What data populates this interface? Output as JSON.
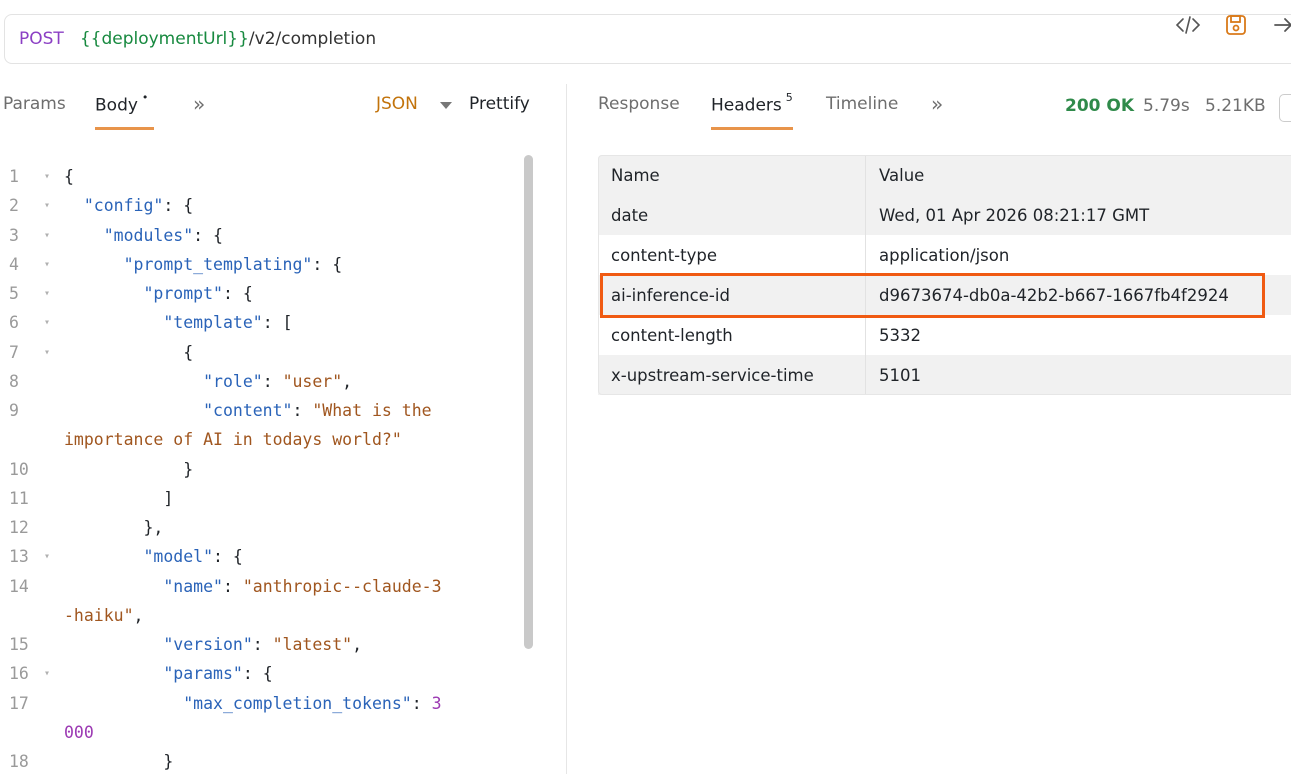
{
  "request": {
    "method": "POST",
    "url_var": "{{deploymentUrl}}",
    "url_path": "/v2/completion"
  },
  "icons": {
    "code": "code-icon",
    "save": "save-icon",
    "arrow": "arrow-right-icon"
  },
  "colors": {
    "accent": "#e8944a",
    "highlight": "#f05a12",
    "status_ok": "#2f8a4a"
  },
  "left_tabs": {
    "params": "Params",
    "body": "Body",
    "body_indicator": "•",
    "more": "»",
    "format": "JSON",
    "prettify": "Prettify"
  },
  "editor": {
    "lines": [
      {
        "num": "1",
        "fold": true,
        "code": [
          {
            "t": "p",
            "v": "{"
          }
        ]
      },
      {
        "num": "2",
        "fold": true,
        "code": [
          {
            "t": "p",
            "v": "  "
          },
          {
            "t": "k",
            "v": "\"config\""
          },
          {
            "t": "p",
            "v": ": {"
          }
        ]
      },
      {
        "num": "3",
        "fold": true,
        "code": [
          {
            "t": "p",
            "v": "    "
          },
          {
            "t": "k",
            "v": "\"modules\""
          },
          {
            "t": "p",
            "v": ": {"
          }
        ]
      },
      {
        "num": "4",
        "fold": true,
        "code": [
          {
            "t": "p",
            "v": "      "
          },
          {
            "t": "k",
            "v": "\"prompt_templating\""
          },
          {
            "t": "p",
            "v": ": {"
          }
        ]
      },
      {
        "num": "5",
        "fold": true,
        "code": [
          {
            "t": "p",
            "v": "        "
          },
          {
            "t": "k",
            "v": "\"prompt\""
          },
          {
            "t": "p",
            "v": ": {"
          }
        ]
      },
      {
        "num": "6",
        "fold": true,
        "code": [
          {
            "t": "p",
            "v": "          "
          },
          {
            "t": "k",
            "v": "\"template\""
          },
          {
            "t": "p",
            "v": ": ["
          }
        ]
      },
      {
        "num": "7",
        "fold": true,
        "code": [
          {
            "t": "p",
            "v": "            {"
          }
        ]
      },
      {
        "num": "8",
        "fold": false,
        "code": [
          {
            "t": "p",
            "v": "              "
          },
          {
            "t": "k",
            "v": "\"role\""
          },
          {
            "t": "p",
            "v": ": "
          },
          {
            "t": "s",
            "v": "\"user\""
          },
          {
            "t": "p",
            "v": ","
          }
        ]
      },
      {
        "num": "9",
        "fold": false,
        "code": [
          {
            "t": "p",
            "v": "              "
          },
          {
            "t": "k",
            "v": "\"content\""
          },
          {
            "t": "p",
            "v": ": "
          },
          {
            "t": "s",
            "v": "\"What is the"
          }
        ]
      },
      {
        "num": "",
        "fold": false,
        "code": [
          {
            "t": "s",
            "v": "importance of AI in todays world?\""
          }
        ]
      },
      {
        "num": "10",
        "fold": false,
        "code": [
          {
            "t": "p",
            "v": "            }"
          }
        ]
      },
      {
        "num": "11",
        "fold": false,
        "code": [
          {
            "t": "p",
            "v": "          ]"
          }
        ]
      },
      {
        "num": "12",
        "fold": false,
        "code": [
          {
            "t": "p",
            "v": "        },"
          }
        ]
      },
      {
        "num": "13",
        "fold": true,
        "code": [
          {
            "t": "p",
            "v": "        "
          },
          {
            "t": "k",
            "v": "\"model\""
          },
          {
            "t": "p",
            "v": ": {"
          }
        ]
      },
      {
        "num": "14",
        "fold": false,
        "code": [
          {
            "t": "p",
            "v": "          "
          },
          {
            "t": "k",
            "v": "\"name\""
          },
          {
            "t": "p",
            "v": ": "
          },
          {
            "t": "s",
            "v": "\"anthropic--claude-3"
          }
        ]
      },
      {
        "num": "",
        "fold": false,
        "code": [
          {
            "t": "s",
            "v": "-haiku\""
          },
          {
            "t": "p",
            "v": ","
          }
        ]
      },
      {
        "num": "15",
        "fold": false,
        "code": [
          {
            "t": "p",
            "v": "          "
          },
          {
            "t": "k",
            "v": "\"version\""
          },
          {
            "t": "p",
            "v": ": "
          },
          {
            "t": "s",
            "v": "\"latest\""
          },
          {
            "t": "p",
            "v": ","
          }
        ]
      },
      {
        "num": "16",
        "fold": true,
        "code": [
          {
            "t": "p",
            "v": "          "
          },
          {
            "t": "k",
            "v": "\"params\""
          },
          {
            "t": "p",
            "v": ": {"
          }
        ]
      },
      {
        "num": "17",
        "fold": false,
        "code": [
          {
            "t": "p",
            "v": "            "
          },
          {
            "t": "k",
            "v": "\"max_completion_tokens\""
          },
          {
            "t": "p",
            "v": ": "
          },
          {
            "t": "n",
            "v": "3"
          }
        ]
      },
      {
        "num": "",
        "fold": false,
        "code": [
          {
            "t": "n",
            "v": "000"
          }
        ]
      },
      {
        "num": "18",
        "fold": false,
        "code": [
          {
            "t": "p",
            "v": "          }"
          }
        ]
      }
    ]
  },
  "right_tabs": {
    "response": "Response",
    "headers": "Headers",
    "headers_count": "5",
    "timeline": "Timeline",
    "more": "»",
    "status": "200 OK",
    "time": "5.79s",
    "size": "5.21KB"
  },
  "headers_table": {
    "columns": [
      "Name",
      "Value"
    ],
    "rows": [
      [
        "date",
        "Wed, 01 Apr 2026 08:21:17 GMT"
      ],
      [
        "content-type",
        "application/json"
      ],
      [
        "ai-inference-id",
        "d9673674-db0a-42b2-b667-1667fb4f2924"
      ],
      [
        "content-length",
        "5332"
      ],
      [
        "x-upstream-service-time",
        "5101"
      ]
    ]
  }
}
